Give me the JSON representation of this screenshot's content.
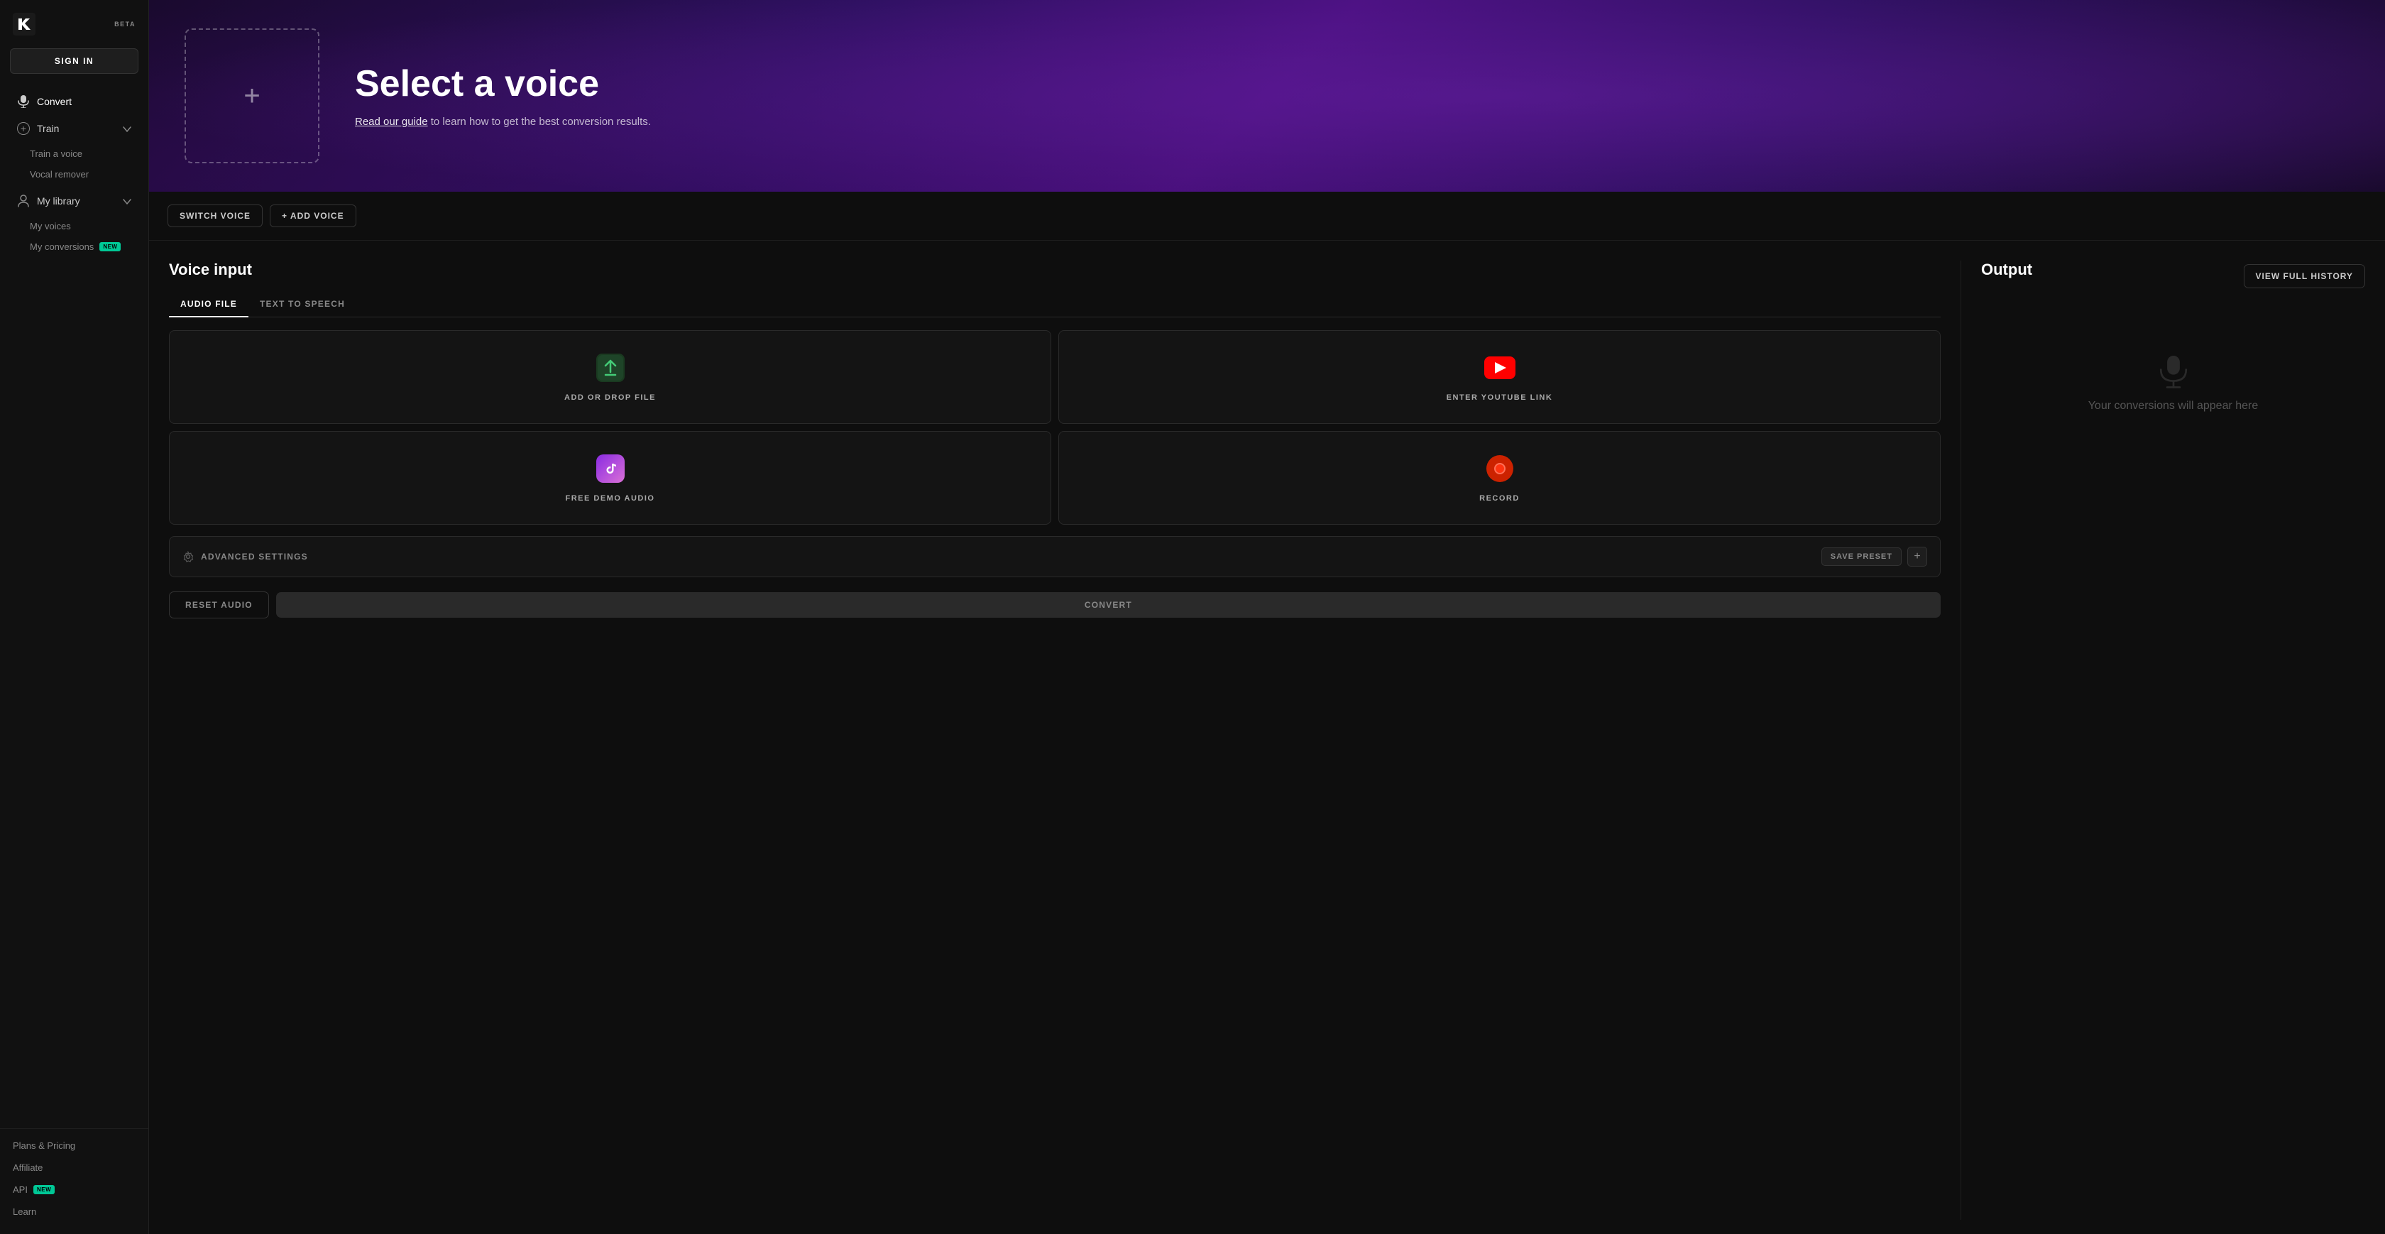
{
  "app": {
    "logo_alt": "Kits AI Logo",
    "beta_label": "BETA"
  },
  "sidebar": {
    "sign_in_label": "SIGN IN",
    "nav_items": [
      {
        "id": "convert",
        "label": "Convert",
        "icon": "microphone",
        "active": true
      },
      {
        "id": "train",
        "label": "Train",
        "icon": "plus-circle",
        "active": false,
        "has_chevron": true
      }
    ],
    "train_sub": [
      {
        "id": "train-voice",
        "label": "Train a voice"
      },
      {
        "id": "vocal-remover",
        "label": "Vocal remover"
      }
    ],
    "library": {
      "label": "My library",
      "icon": "person",
      "sub_items": [
        {
          "id": "my-voices",
          "label": "My voices"
        },
        {
          "id": "my-conversions",
          "label": "My conversions",
          "badge": "NEW"
        }
      ]
    },
    "footer_items": [
      {
        "id": "plans",
        "label": "Plans & Pricing"
      },
      {
        "id": "affiliate",
        "label": "Affiliate"
      },
      {
        "id": "api",
        "label": "API",
        "badge": "NEW"
      },
      {
        "id": "learn",
        "label": "Learn"
      }
    ]
  },
  "hero": {
    "title": "Select a voice",
    "subtitle_pre": "Read our guide",
    "subtitle_link": "Read our guide",
    "subtitle_post": " to learn how to get the best conversion results.",
    "voice_box_plus": "+"
  },
  "voice_controls": {
    "switch_voice_label": "SWITCH VOICE",
    "add_voice_label": "+ ADD VOICE"
  },
  "voice_input": {
    "section_title": "Voice input",
    "tabs": [
      {
        "id": "audio-file",
        "label": "AUDIO FILE",
        "active": true
      },
      {
        "id": "text-to-speech",
        "label": "TEXT TO SPEECH",
        "active": false
      }
    ],
    "cards": [
      {
        "id": "upload",
        "label": "ADD OR DROP FILE",
        "icon": "upload"
      },
      {
        "id": "youtube",
        "label": "ENTER YOUTUBE LINK",
        "icon": "youtube"
      },
      {
        "id": "demo",
        "label": "FREE DEMO AUDIO",
        "icon": "tiktok"
      },
      {
        "id": "record",
        "label": "RECORD",
        "icon": "record"
      }
    ],
    "advanced_settings_label": "ADVANCED SETTINGS",
    "save_preset_label": "SAVE PRESET",
    "reset_label": "RESET AUDIO",
    "convert_label": "CONVERT"
  },
  "output": {
    "section_title": "Output",
    "view_history_label": "VIEW FULL HISTORY",
    "empty_text": "Your conversions will appear here"
  }
}
